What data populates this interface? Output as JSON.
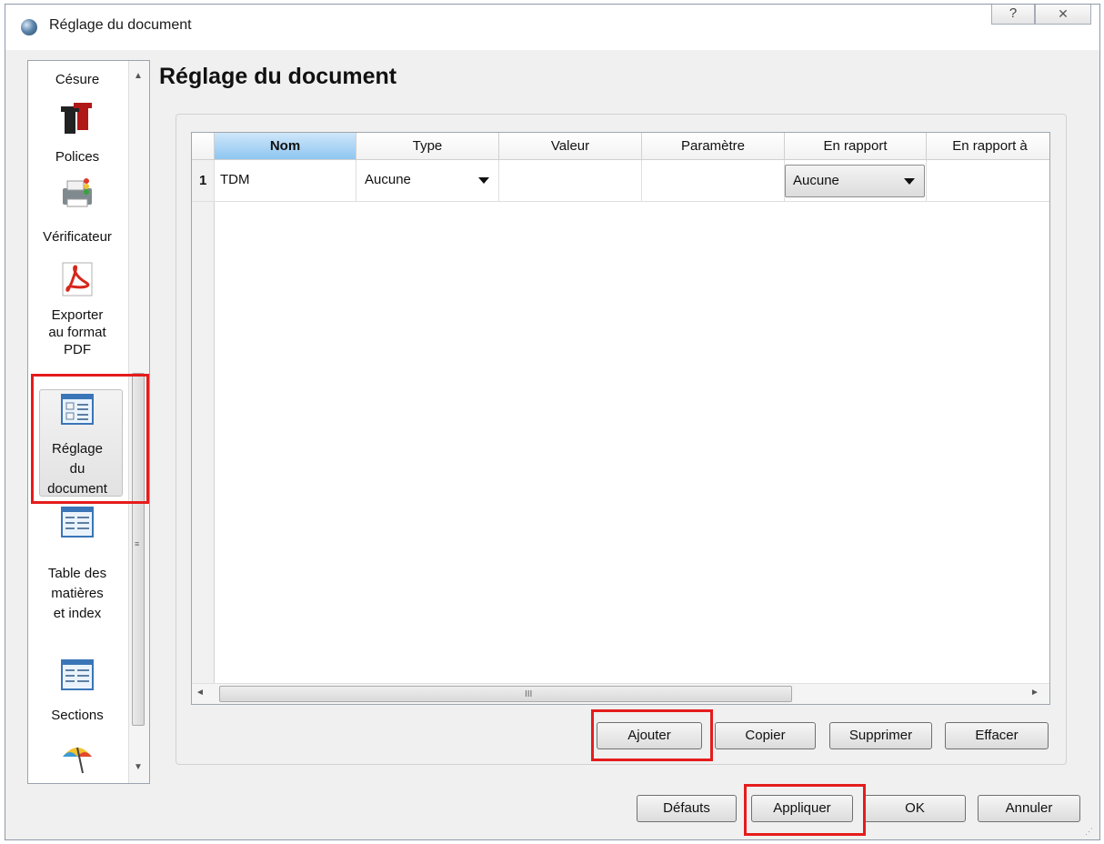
{
  "window": {
    "title": "Réglage du document",
    "help_symbol": "?",
    "close_symbol": "✕"
  },
  "sidebar": {
    "scroll_up": "▲",
    "scroll_down": "▼",
    "scroll_grip": "≡",
    "items": [
      {
        "label": "Césure",
        "icon": "hyphenation-icon"
      },
      {
        "label": "Polices",
        "icon": "fonts-icon"
      },
      {
        "label": "Vérificateur",
        "icon": "printer-checker-icon"
      },
      {
        "label": "Exporter au format PDF",
        "icon": "pdf-icon"
      },
      {
        "label": "Réglage du document",
        "icon": "document-settings-icon",
        "selected": true
      },
      {
        "label": "Table des matières et index",
        "icon": "toc-icon"
      },
      {
        "label": "Sections",
        "icon": "sections-icon"
      },
      {
        "label": "",
        "icon": "umbrella-icon"
      }
    ]
  },
  "page": {
    "title": "Réglage du document"
  },
  "table": {
    "columns": [
      "Nom",
      "Type",
      "Valeur",
      "Paramètre",
      "En rapport",
      "En rapport à"
    ],
    "rows": [
      {
        "index": "1",
        "nom": "TDM",
        "type": "Aucune",
        "valeur": "",
        "parametre": "",
        "en_rapport": "Aucune",
        "en_rapport_a": ""
      }
    ],
    "hscroll_left": "◄",
    "hscroll_right": "►",
    "hscroll_grip": "III"
  },
  "buttons": {
    "ajouter": "Ajouter",
    "copier": "Copier",
    "supprimer": "Supprimer",
    "effacer": "Effacer",
    "defauts": "Défauts",
    "appliquer": "Appliquer",
    "ok": "OK",
    "annuler": "Annuler"
  },
  "colors": {
    "highlight": "#e51c1c",
    "selected_header": "#8ec6f1"
  }
}
